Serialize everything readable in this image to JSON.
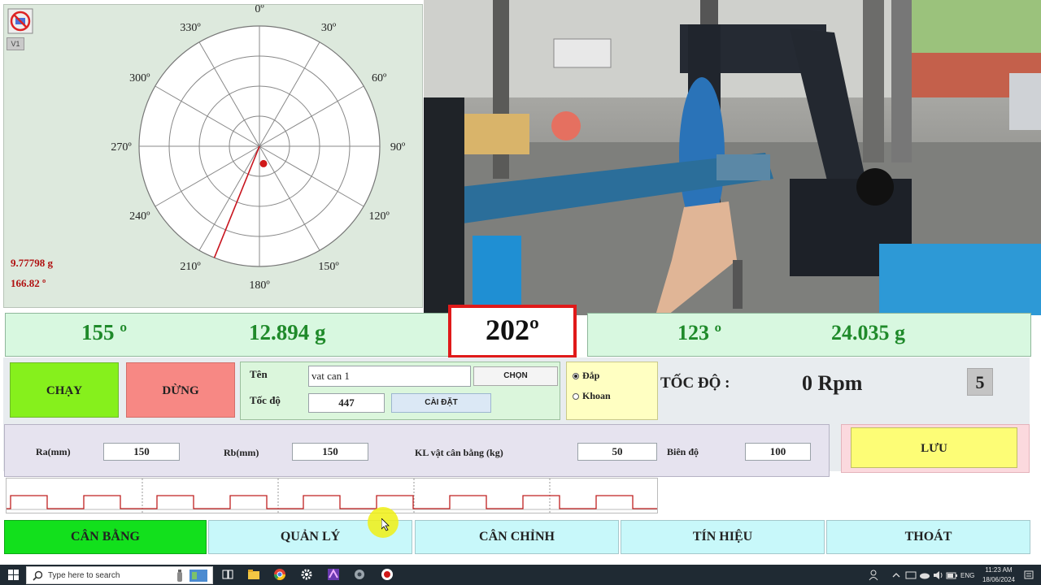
{
  "polar": {
    "badge": "V1",
    "angle_labels": [
      "0º",
      "30º",
      "60º",
      "90º",
      "120º",
      "150º",
      "180º",
      "210º",
      "240º",
      "270º",
      "300º",
      "330º"
    ],
    "pointer_angle_deg": 202,
    "dot_angle_deg": 166.82,
    "readout_mass": "9.77798 g",
    "readout_angle": "166.82 º"
  },
  "readouts": {
    "left_angle": "155 º",
    "left_mass": "12.894 g",
    "center_angle": "202º",
    "right_angle": "123 º",
    "right_mass": "24.035 g"
  },
  "controls": {
    "run_label": "CHẠY",
    "stop_label": "DỪNG",
    "name_label": "Tên",
    "name_value": "vat can 1",
    "choose_label": "CHỌN",
    "speed_label": "Tốc độ",
    "speed_value": "447",
    "settings_label": "CÀI ĐẶT",
    "mode_options": [
      {
        "label": "Đắp",
        "selected": true
      },
      {
        "label": "Khoan",
        "selected": false
      }
    ],
    "speed_display_label": "TỐC ĐỘ :",
    "rpm_value": "0 Rpm",
    "counter_value": "5"
  },
  "params": {
    "ra_label": "Ra(mm)",
    "ra_value": "150",
    "rb_label": "Rb(mm)",
    "rb_value": "150",
    "kl_label": "KL vật cân bằng (kg)",
    "kl_value": "50",
    "amp_label": "Biên độ",
    "amp_value": "100",
    "save_label": "LƯU"
  },
  "tabs": [
    {
      "label": "CÂN BẰNG",
      "active": true
    },
    {
      "label": "QUẢN LÝ",
      "active": false
    },
    {
      "label": "CÂN CHỈNH",
      "active": false
    },
    {
      "label": "TÍN HIỆU",
      "active": false
    },
    {
      "label": "THOÁT",
      "active": false
    }
  ],
  "taskbar": {
    "search_placeholder": "Type here to search",
    "lang": "ENG",
    "time": "11:23 AM",
    "date": "18/06/2024"
  },
  "colors": {
    "pointer": "#c8141e",
    "readout_green": "#1f8a2a",
    "active_tab": "#12e01c",
    "highlight_box": "#e01a1a"
  }
}
